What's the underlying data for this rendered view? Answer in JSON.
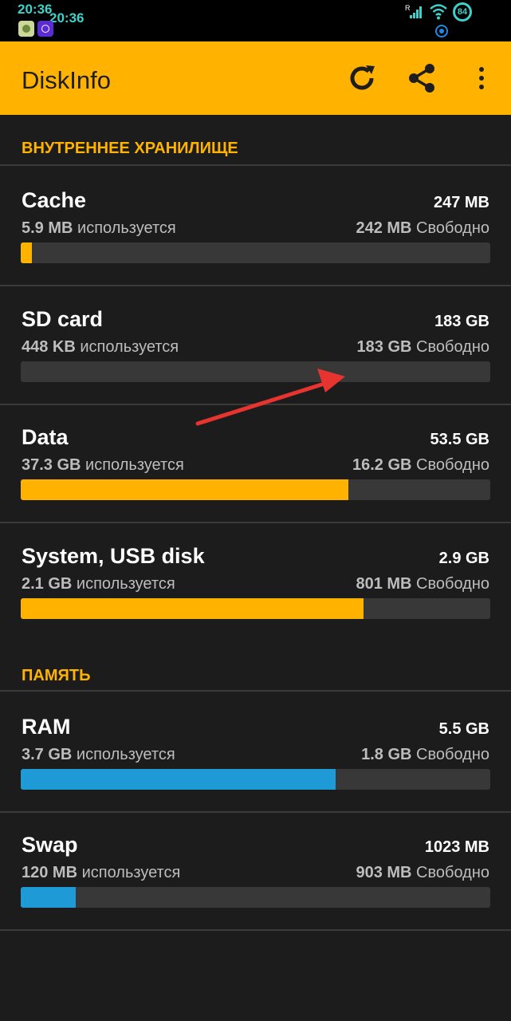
{
  "status_bar": {
    "time": "20:36",
    "battery": "84",
    "signal_label": "R"
  },
  "app_bar": {
    "title": "DiskInfo",
    "actions": [
      "refresh-icon",
      "share-icon",
      "more-vert-icon"
    ]
  },
  "colors": {
    "accent": "#ffb300",
    "memory_bar": "#1e9ad6",
    "track": "#383838",
    "background": "#1c1c1c"
  },
  "sections": [
    {
      "title": "ВНУТРЕННЕЕ ХРАНИЛИЩЕ",
      "items": [
        {
          "name": "Cache",
          "total": "247 MB",
          "used_value": "5.9 MB",
          "used_label": "используется",
          "free_value": "242 MB",
          "free_label": "Свободно",
          "fill_fraction": 0.024,
          "bar_color": "#ffb300"
        },
        {
          "name": "SD card",
          "total": "183 GB",
          "used_value": "448 KB",
          "used_label": "используется",
          "free_value": "183 GB",
          "free_label": "Свободно",
          "fill_fraction": 0.0,
          "bar_color": "#ffb300"
        },
        {
          "name": "Data",
          "total": "53.5 GB",
          "used_value": "37.3 GB",
          "used_label": "используется",
          "free_value": "16.2 GB",
          "free_label": "Свободно",
          "fill_fraction": 0.697,
          "bar_color": "#ffb300"
        },
        {
          "name": "System, USB disk",
          "total": "2.9 GB",
          "used_value": "2.1 GB",
          "used_label": "используется",
          "free_value": "801 MB",
          "free_label": "Свободно",
          "fill_fraction": 0.73,
          "bar_color": "#ffb300"
        }
      ]
    },
    {
      "title": "ПАМЯТЬ",
      "items": [
        {
          "name": "RAM",
          "total": "5.5 GB",
          "used_value": "3.7 GB",
          "used_label": "используется",
          "free_value": "1.8 GB",
          "free_label": "Свободно",
          "fill_fraction": 0.67,
          "bar_color": "#1e9ad6"
        },
        {
          "name": "Swap",
          "total": "1023 MB",
          "used_value": "120 MB",
          "used_label": "используется",
          "free_value": "903 MB",
          "free_label": "Свободно",
          "fill_fraction": 0.117,
          "bar_color": "#1e9ad6"
        }
      ]
    }
  ]
}
